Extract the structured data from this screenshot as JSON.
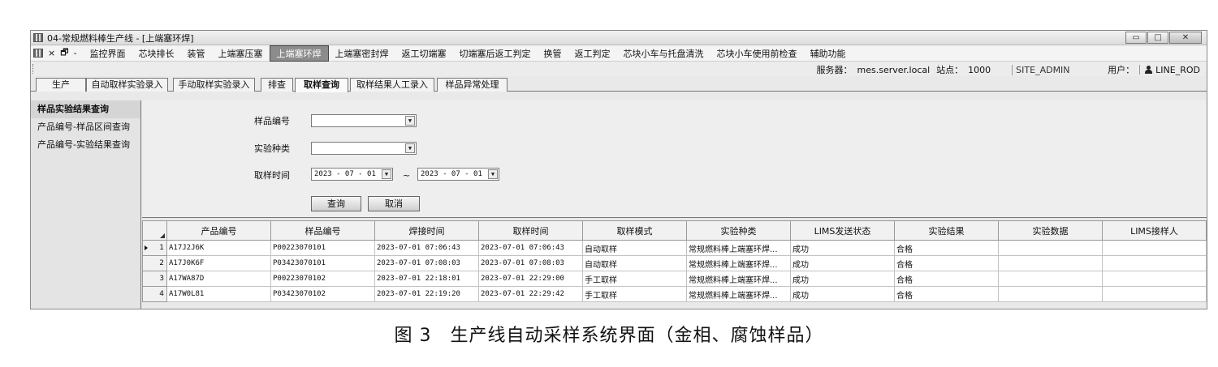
{
  "window": {
    "title": "04-常规燃料棒生产线 - [上端塞环焊]",
    "controls": {
      "minimize": "▭",
      "maximize": "□",
      "close": "✕"
    }
  },
  "menu": {
    "ctrl": {
      "close": "×",
      "restore": "🗗",
      "minimize": "-"
    },
    "items": [
      {
        "label": "监控界面"
      },
      {
        "label": "芯块排长"
      },
      {
        "label": "装管"
      },
      {
        "label": "上端塞压塞"
      },
      {
        "label": "上端塞环焊",
        "active": true
      },
      {
        "label": "上端塞密封焊"
      },
      {
        "label": "返工切端塞"
      },
      {
        "label": "切端塞后返工判定"
      },
      {
        "label": "换管"
      },
      {
        "label": "返工判定"
      },
      {
        "label": "芯块小车与托盘清洗"
      },
      {
        "label": "芯块小车使用前检查"
      },
      {
        "label": "辅助功能"
      }
    ]
  },
  "status": {
    "server_label": "服务器：",
    "server_value": "mes.server.local",
    "station_label": "站点：",
    "station_value": "1000",
    "site": "SITE_ADMIN",
    "user_label": "用户：",
    "user_value": "LINE_ROD"
  },
  "tabs": [
    "生产",
    "自动取样实验录入",
    "手动取样实验录入",
    "排查",
    "取样查询",
    "取样结果人工录入",
    "样品异常处理"
  ],
  "active_tab": "取样查询",
  "left_nav": [
    "样品实验结果查询",
    "产品编号-样品区间查询",
    "产品编号-实验结果查询"
  ],
  "query": {
    "sample_no_label": "样品编号",
    "sample_no_value": "",
    "test_type_label": "实验种类",
    "test_type_value": "",
    "sample_time_label": "取样时间",
    "date_from": "2023 - 07 - 01",
    "date_to": "2023 - 07 - 01",
    "range_sep": "~",
    "query_button": "查询",
    "cancel_button": "取消"
  },
  "grid": {
    "columns": [
      "产品编号",
      "样品编号",
      "焊接时间",
      "取样时间",
      "取样模式",
      "实验种类",
      "LIMS发送状态",
      "实验结果",
      "实验数据",
      "LIMS接样人"
    ],
    "rows": [
      {
        "num": "1",
        "cells": [
          "A17J2J6K",
          "P00223070101",
          "2023-07-01 07:06:43",
          "2023-07-01 07:06:43",
          "自动取样",
          "常规燃料棒上端塞环焊...",
          "成功",
          "合格",
          "",
          ""
        ]
      },
      {
        "num": "2",
        "cells": [
          "A17J0K6F",
          "P03423070101",
          "2023-07-01 07:08:03",
          "2023-07-01 07:08:03",
          "自动取样",
          "常规燃料棒上端塞环焊...",
          "成功",
          "合格",
          "",
          ""
        ]
      },
      {
        "num": "3",
        "cells": [
          "A17WA87D",
          "P00223070102",
          "2023-07-01 22:18:01",
          "2023-07-01 22:29:00",
          "手工取样",
          "常规燃料棒上端塞环焊...",
          "成功",
          "合格",
          "",
          ""
        ]
      },
      {
        "num": "4",
        "cells": [
          "A17W0L81",
          "P03423070102",
          "2023-07-01 22:19:20",
          "2023-07-01 22:29:42",
          "手工取样",
          "常规燃料棒上端塞环焊...",
          "成功",
          "合格",
          "",
          ""
        ]
      }
    ]
  },
  "caption": "图 3　生产线自动采样系统界面（金相、腐蚀样品）"
}
